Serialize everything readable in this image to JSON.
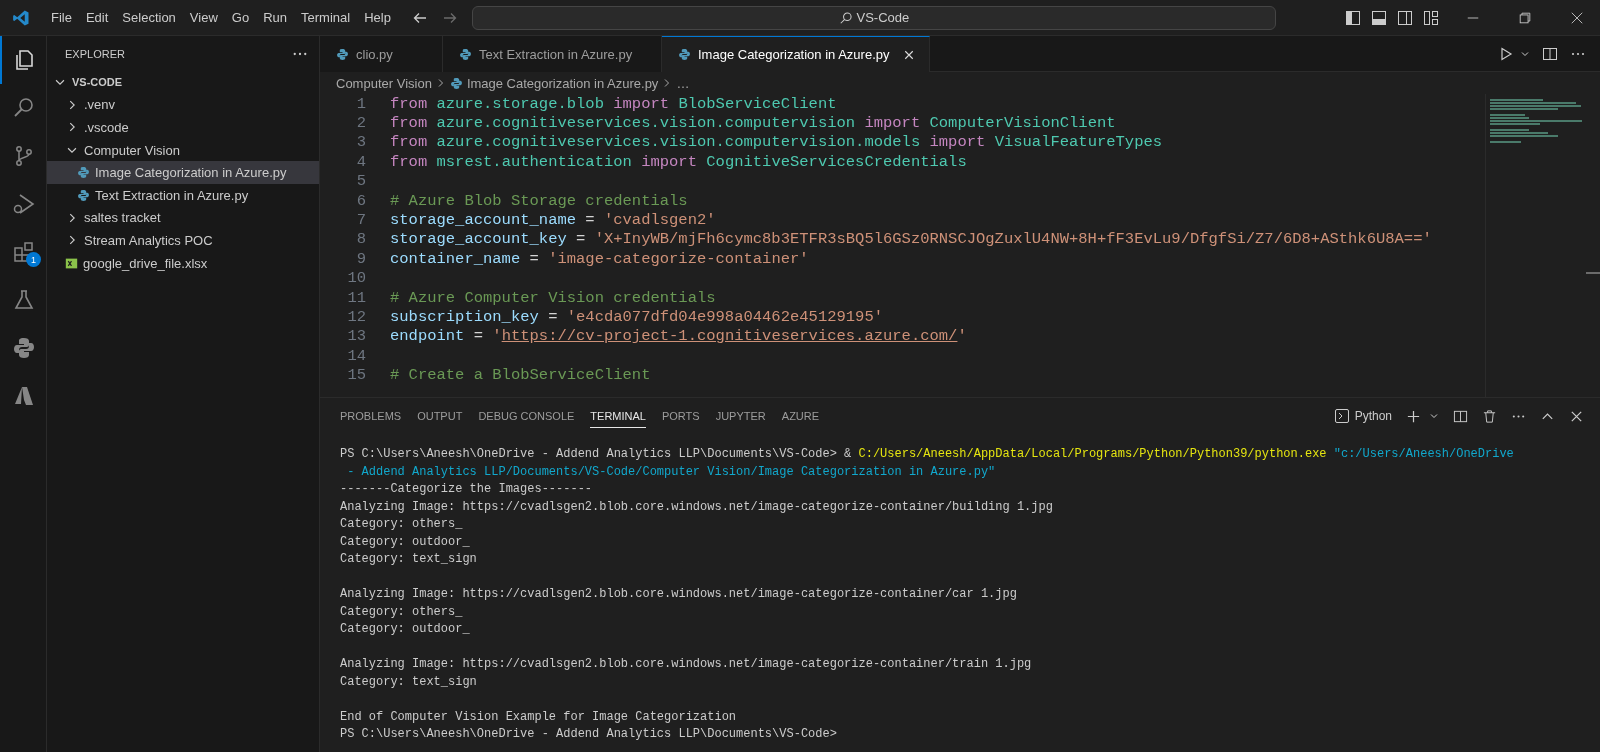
{
  "menu": [
    "File",
    "Edit",
    "Selection",
    "View",
    "Go",
    "Run",
    "Terminal",
    "Help"
  ],
  "command_center": {
    "label": "VS-Code"
  },
  "activity_bar": [
    {
      "kind": "explorer",
      "selected": true
    },
    {
      "kind": "search",
      "selected": false
    },
    {
      "kind": "source-control",
      "selected": false
    },
    {
      "kind": "run-debug",
      "selected": false
    },
    {
      "kind": "extensions",
      "selected": false,
      "badge": "1"
    },
    {
      "kind": "testing",
      "selected": false
    },
    {
      "kind": "python",
      "selected": false
    },
    {
      "kind": "azure",
      "selected": false
    }
  ],
  "explorer": {
    "title": "EXPLORER",
    "tree": [
      {
        "label": "VS-CODE",
        "kind": "root",
        "expanded": true,
        "selected": false,
        "children": [
          {
            "label": ".venv",
            "kind": "folder",
            "expanded": false,
            "selected": false
          },
          {
            "label": ".vscode",
            "kind": "folder",
            "expanded": false,
            "selected": false
          },
          {
            "label": "Computer Vision",
            "kind": "folder",
            "expanded": true,
            "selected": false,
            "children": [
              {
                "label": "Image Categorization in Azure.py",
                "kind": "python",
                "selected": true
              },
              {
                "label": "Text Extraction in Azure.py",
                "kind": "python",
                "selected": false
              }
            ]
          },
          {
            "label": "saltes tracket",
            "kind": "folder",
            "expanded": false,
            "selected": false
          },
          {
            "label": "Stream Analytics POC",
            "kind": "folder",
            "expanded": false,
            "selected": false
          },
          {
            "label": "google_drive_file.xlsx",
            "kind": "excel",
            "selected": false
          }
        ]
      }
    ]
  },
  "tabs": [
    {
      "label": "clio.py",
      "selected": false
    },
    {
      "label": "Text Extraction in Azure.py",
      "selected": false
    },
    {
      "label": "Image Categorization in Azure.py",
      "selected": true
    }
  ],
  "breadcrumb": [
    "Computer Vision",
    "Image Categorization in Azure.py",
    "…"
  ],
  "code": [
    {
      "number": "1",
      "tokens": [
        {
          "kind": "kw",
          "text": "from "
        },
        {
          "kind": "mod",
          "text": "azure.storage.blob "
        },
        {
          "kind": "kw",
          "text": "import "
        },
        {
          "kind": "cls",
          "text": "BlobServiceClient"
        }
      ]
    },
    {
      "number": "2",
      "tokens": [
        {
          "kind": "kw",
          "text": "from "
        },
        {
          "kind": "mod",
          "text": "azure.cognitiveservices.vision.computervision "
        },
        {
          "kind": "kw",
          "text": "import "
        },
        {
          "kind": "cls",
          "text": "ComputerVisionClient"
        }
      ]
    },
    {
      "number": "3",
      "tokens": [
        {
          "kind": "kw",
          "text": "from "
        },
        {
          "kind": "mod",
          "text": "azure.cognitiveservices.vision.computervision.models "
        },
        {
          "kind": "kw",
          "text": "import "
        },
        {
          "kind": "cls",
          "text": "VisualFeatureTypes"
        }
      ]
    },
    {
      "number": "4",
      "tokens": [
        {
          "kind": "kw",
          "text": "from "
        },
        {
          "kind": "mod",
          "text": "msrest.authentication "
        },
        {
          "kind": "kw",
          "text": "import "
        },
        {
          "kind": "cls",
          "text": "CognitiveServicesCredentials"
        }
      ]
    },
    {
      "number": "5"
    },
    {
      "number": "6",
      "tokens": [
        {
          "kind": "cmt",
          "text": "# Azure Blob Storage credentials"
        }
      ]
    },
    {
      "number": "7",
      "tokens": [
        {
          "kind": "var",
          "text": "storage_account_name"
        },
        {
          "kind": "op",
          "text": " = "
        },
        {
          "kind": "str",
          "text": "'cvadlsgen2'"
        }
      ]
    },
    {
      "number": "8",
      "tokens": [
        {
          "kind": "var",
          "text": "storage_account_key"
        },
        {
          "kind": "op",
          "text": " = "
        },
        {
          "kind": "str",
          "text": "'X+InyWB/mjFh6cymc8b3ETFR3sBQ5l6GSz0RNSCJOgZuxlU4NW+8H+fF3EvLu9/DfgfSi/Z7/6D8+ASthk6U8A=='"
        }
      ]
    },
    {
      "number": "9",
      "tokens": [
        {
          "kind": "var",
          "text": "container_name"
        },
        {
          "kind": "op",
          "text": " = "
        },
        {
          "kind": "str",
          "text": "'image-categorize-container'"
        }
      ]
    },
    {
      "number": "10"
    },
    {
      "number": "11",
      "tokens": [
        {
          "kind": "cmt",
          "text": "# Azure Computer Vision credentials"
        }
      ]
    },
    {
      "number": "12",
      "tokens": [
        {
          "kind": "var",
          "text": "subscription_key"
        },
        {
          "kind": "op",
          "text": " = "
        },
        {
          "kind": "str",
          "text": "'e4cda077dfd04e998a04462e45129195'"
        }
      ]
    },
    {
      "number": "13",
      "tokens": [
        {
          "kind": "var",
          "text": "endpoint"
        },
        {
          "kind": "op",
          "text": " = "
        },
        {
          "kind": "str",
          "text": "'"
        },
        {
          "kind": "link",
          "text": "https://cv-project-1.cognitiveservices.azure.com/"
        },
        {
          "kind": "str",
          "text": "'"
        }
      ]
    },
    {
      "number": "14"
    },
    {
      "number": "15",
      "tokens": [
        {
          "kind": "cmt",
          "text": "# Create a BlobServiceClient"
        }
      ]
    }
  ],
  "panel": {
    "tabs": [
      {
        "label": "PROBLEMS",
        "selected": false
      },
      {
        "label": "OUTPUT",
        "selected": false
      },
      {
        "label": "DEBUG CONSOLE",
        "selected": false
      },
      {
        "label": "TERMINAL",
        "selected": true
      },
      {
        "label": "PORTS",
        "selected": false
      },
      {
        "label": "JUPYTER",
        "selected": false
      },
      {
        "label": "AZURE",
        "selected": false
      }
    ],
    "terminal_profile": "Python",
    "terminal": [
      [
        [
          {
            "kind": "plain",
            "text": "PS C:\\Users\\Aneesh\\OneDrive - Addend Analytics LLP\\Documents\\VS-Code> & "
          },
          {
            "kind": "path",
            "text": "C:/Users/Aneesh/AppData/Local/Programs/Python/Python39/python.exe"
          },
          {
            "kind": "string",
            "text": " \"c:/Users/Aneesh/OneDrive"
          }
        ],
        [
          {
            "kind": "string",
            "text": " - Addend Analytics LLP/Documents/VS-Code/Computer Vision/Image Categorization in Azure.py\""
          }
        ],
        [
          {
            "kind": "plain",
            "text": "-------Categorize the Images-------"
          }
        ],
        [
          {
            "kind": "plain",
            "text": "Analyzing Image: https://cvadlsgen2.blob.core.windows.net/image-categorize-container/building 1.jpg"
          }
        ],
        [
          {
            "kind": "plain",
            "text": "Category: others_"
          }
        ],
        [
          {
            "kind": "plain",
            "text": "Category: outdoor_"
          }
        ],
        [
          {
            "kind": "plain",
            "text": "Category: text_sign"
          }
        ]
      ],
      [
        [
          {
            "kind": "plain",
            "text": "Analyzing Image: https://cvadlsgen2.blob.core.windows.net/image-categorize-container/car 1.jpg"
          }
        ],
        [
          {
            "kind": "plain",
            "text": "Category: others_"
          }
        ],
        [
          {
            "kind": "plain",
            "text": "Category: outdoor_"
          }
        ]
      ],
      [
        [
          {
            "kind": "plain",
            "text": "Analyzing Image: https://cvadlsgen2.blob.core.windows.net/image-categorize-container/train 1.jpg"
          }
        ],
        [
          {
            "kind": "plain",
            "text": "Category: text_sign"
          }
        ]
      ],
      [
        [
          {
            "kind": "plain",
            "text": "End of Computer Vision Example for Image Categorization"
          }
        ],
        [
          {
            "kind": "plain",
            "text": "PS C:\\Users\\Aneesh\\OneDrive - Addend Analytics LLP\\Documents\\VS-Code>"
          }
        ]
      ]
    ]
  }
}
